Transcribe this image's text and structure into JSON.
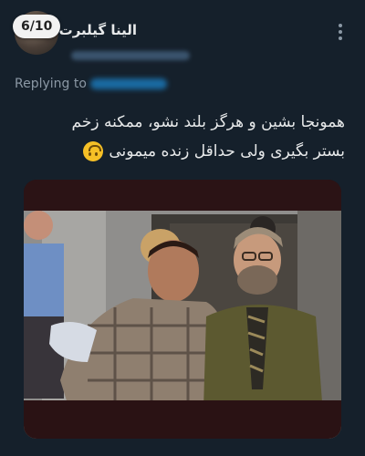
{
  "tweet": {
    "counter": "6/10",
    "display_name": "الینا گیلبرت",
    "reply_prefix": "Replying to",
    "text_lines": [
      "همونجا بشین و هرگز بلند نشو، ممکنه زخم",
      "بستر بگیری ولی حداقل زنده میمونی"
    ],
    "emoji": "upside-down-face",
    "media": {
      "kind": "photo"
    }
  }
}
